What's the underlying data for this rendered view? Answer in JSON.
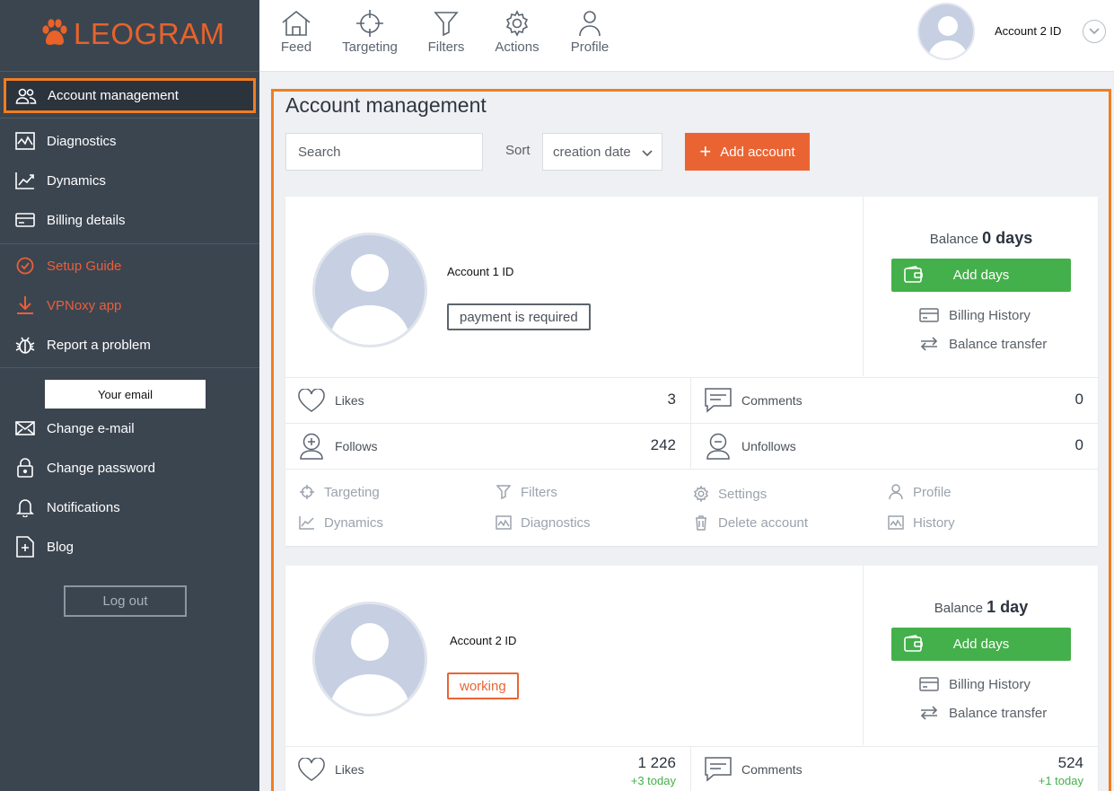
{
  "brand": {
    "logo_text": "LEOGRAM",
    "accent": "#e8622a"
  },
  "sidebar": {
    "active_item": {
      "label": "Account management",
      "icon": "users-icon"
    },
    "items": [
      {
        "label": "Diagnostics",
        "icon": "pulse-chart-icon"
      },
      {
        "label": "Dynamics",
        "icon": "trend-chart-icon"
      },
      {
        "label": "Billing details",
        "icon": "credit-card-icon"
      },
      {
        "label": "Setup Guide",
        "icon": "check-circle-icon"
      },
      {
        "label": "VPNoxy app",
        "icon": "download-icon"
      },
      {
        "label": "Report a problem",
        "icon": "bug-icon"
      },
      {
        "label": "Change e-mail",
        "icon": "envelope-icon"
      },
      {
        "label": "Change password",
        "icon": "lock-icon"
      },
      {
        "label": "Notifications",
        "icon": "bell-icon"
      },
      {
        "label": "Blog",
        "icon": "blog-icon"
      }
    ],
    "email": "Your email",
    "logout_label": "Log out"
  },
  "topnav": {
    "items": [
      {
        "label": "Feed",
        "icon": "home-icon"
      },
      {
        "label": "Targeting",
        "icon": "crosshair-icon"
      },
      {
        "label": "Filters",
        "icon": "filter-icon"
      },
      {
        "label": "Actions",
        "icon": "gear-icon"
      },
      {
        "label": "Profile",
        "icon": "user-icon"
      }
    ],
    "account_name": "Account 2 ID"
  },
  "page": {
    "title": "Account management",
    "search_placeholder": "Search",
    "sort_label": "Sort",
    "sort_value": "creation date",
    "add_account_label": "Add account"
  },
  "accounts": [
    {
      "name": "Account 1 ID",
      "status": "payment is required",
      "balance_label": "Balance",
      "balance_value": "0 days",
      "add_days_label": "Add days",
      "billing_history_label": "Billing History",
      "balance_transfer_label": "Balance transfer",
      "stats": {
        "likes_label": "Likes",
        "likes": "3",
        "comments_label": "Comments",
        "comments": "0",
        "follows_label": "Follows",
        "follows": "242",
        "unfollows_label": "Unfollows",
        "unfollows": "0"
      },
      "actions": {
        "targeting": "Targeting",
        "filters": "Filters",
        "settings": "Settings",
        "profile": "Profile",
        "dynamics": "Dynamics",
        "diagnostics": "Diagnostics",
        "delete": "Delete account",
        "history": "History"
      }
    },
    {
      "name": "Account 2 ID",
      "status": "working",
      "balance_label": "Balance",
      "balance_value": "1 day",
      "add_days_label": "Add days",
      "billing_history_label": "Billing History",
      "balance_transfer_label": "Balance transfer",
      "stats": {
        "likes_label": "Likes",
        "likes": "1 226",
        "likes_today": "+3 today",
        "comments_label": "Comments",
        "comments": "524",
        "comments_today": "+1 today"
      }
    }
  ]
}
